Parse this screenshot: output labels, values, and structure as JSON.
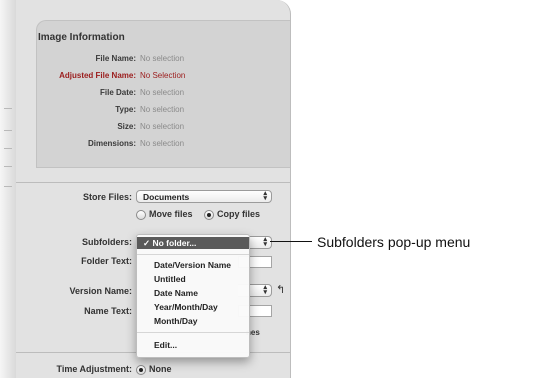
{
  "image_info": {
    "title": "Image Information",
    "rows": [
      {
        "label": "File Name:",
        "value": "No selection"
      },
      {
        "label": "Adjusted File Name:",
        "value": "No Selection"
      },
      {
        "label": "File Date:",
        "value": "No selection"
      },
      {
        "label": "Type:",
        "value": "No selection"
      },
      {
        "label": "Size:",
        "value": "No selection"
      },
      {
        "label": "Dimensions:",
        "value": "No selection"
      }
    ]
  },
  "store_files": {
    "label": "Store Files:",
    "value": "Documents",
    "options": [
      {
        "label": "Move files",
        "selected": false
      },
      {
        "label": "Copy files",
        "selected": true
      }
    ]
  },
  "subfolders": {
    "label": "Subfolders:",
    "menu": {
      "selected": "✓ No folder...",
      "items": [
        "Date/Version Name",
        "Untitled",
        "Date Name",
        "Year/Month/Day",
        "Month/Day"
      ],
      "edit": "Edit..."
    }
  },
  "folder_text": {
    "label": "Folder Text:"
  },
  "version_name": {
    "label": "Version Name:"
  },
  "name_text": {
    "label": "Name Text:"
  },
  "ghost_text": "nes",
  "time_adjustment": {
    "label": "Time Adjustment:",
    "option": "None"
  },
  "callout": {
    "text": "Subfolders pop-up menu"
  },
  "colors": {
    "accent_red": "#9b1c1c",
    "menu_highlight": "#5a5a5a"
  }
}
